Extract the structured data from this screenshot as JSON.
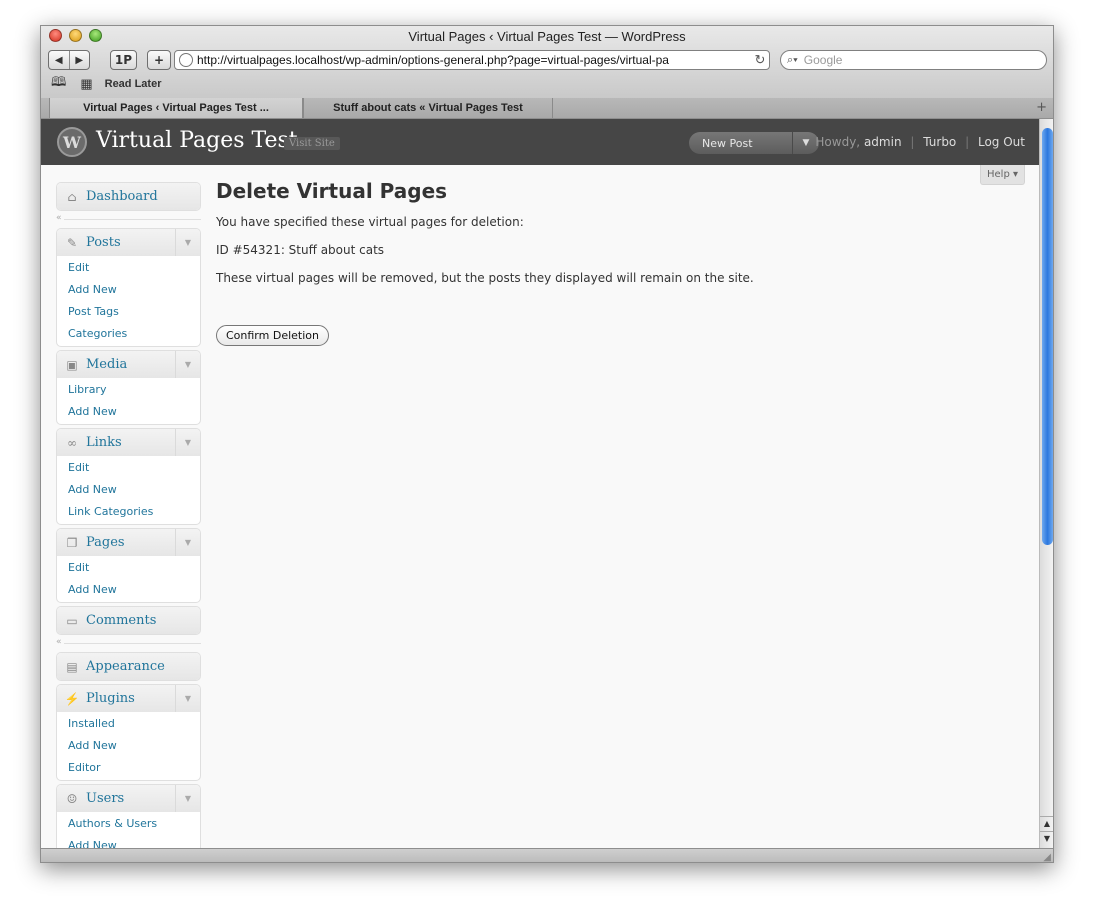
{
  "browser": {
    "window_title": "Virtual Pages ‹ Virtual Pages Test — WordPress",
    "back_glyph": "◀",
    "forward_glyph": "▶",
    "onepassword_label": "1P",
    "add_label": "+",
    "url": "http://virtualpages.localhost/wp-admin/options-general.php?page=virtual-pages/virtual-pa",
    "reload_glyph": "↻",
    "search_placeholder": "Google",
    "bookmarks_label": "Read Later",
    "tabs": [
      {
        "label": "Virtual Pages ‹ Virtual Pages Test ...",
        "active": true
      },
      {
        "label": "Stuff about cats « Virtual Pages Test",
        "active": false
      }
    ],
    "new_tab_glyph": "+"
  },
  "header": {
    "logo_letter": "W",
    "site_title": "Virtual Pages Test",
    "visit_site": "Visit Site",
    "new_post": "New Post",
    "new_post_arrow": "▼",
    "howdy": "Howdy,",
    "user": "admin",
    "turbo": "Turbo",
    "logout": "Log Out",
    "sep": "|"
  },
  "help": {
    "label": "Help ▾"
  },
  "menu": {
    "dashboard": "Dashboard",
    "posts": {
      "label": "Posts",
      "items": [
        "Edit",
        "Add New",
        "Post Tags",
        "Categories"
      ]
    },
    "media": {
      "label": "Media",
      "items": [
        "Library",
        "Add New"
      ]
    },
    "links": {
      "label": "Links",
      "items": [
        "Edit",
        "Add New",
        "Link Categories"
      ]
    },
    "pages": {
      "label": "Pages",
      "items": [
        "Edit",
        "Add New"
      ]
    },
    "comments": "Comments",
    "appearance": "Appearance",
    "plugins": {
      "label": "Plugins",
      "items": [
        "Installed",
        "Add New",
        "Editor"
      ]
    },
    "users": {
      "label": "Users",
      "items": [
        "Authors & Users",
        "Add New"
      ]
    },
    "toggle_glyph": "▼",
    "collapse_glyph": "«"
  },
  "main": {
    "title": "Delete Virtual Pages",
    "intro": "You have specified these virtual pages for deletion:",
    "item": "ID #54321: Stuff about cats",
    "note": "These virtual pages will be removed, but the posts they displayed will remain on the site.",
    "confirm_button": "Confirm Deletion"
  },
  "scroll": {
    "up_glyph": "▲",
    "down_glyph": "▼"
  },
  "icons": {
    "dashboard": "house-icon",
    "posts": "pushpin-icon",
    "media": "camera-icon",
    "links": "chain-link-icon",
    "pages": "pages-icon",
    "comments": "speech-bubble-icon",
    "appearance": "window-layout-icon",
    "plugins": "plug-icon",
    "users": "people-icon"
  },
  "colors": {
    "wp_link": "#21759b",
    "header_bg": "#464646",
    "scroll_thumb": "#2b77de"
  }
}
